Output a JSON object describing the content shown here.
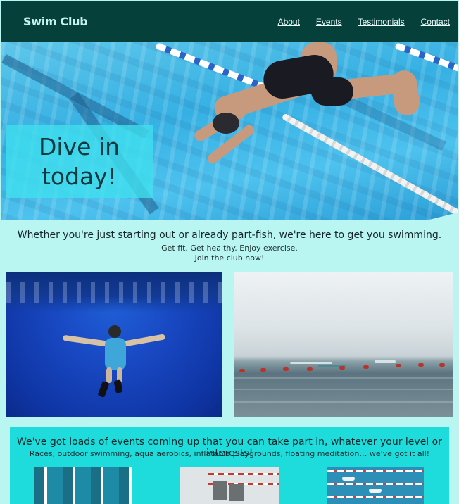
{
  "header": {
    "brand": "Swim Club",
    "nav": [
      "About",
      "Events",
      "Testimonials",
      "Contact"
    ]
  },
  "hero": {
    "title": "Dive in today!"
  },
  "intro": {
    "lead": "Whether you're just starting out or already part-fish, we're here to get you swimming.",
    "line1": "Get fit. Get healthy. Enjoy exercise.",
    "line2": "Join the club now!"
  },
  "events": {
    "heading": "We've got loads of events coming up that you can take part in, whatever your level or interests!",
    "subheading": "Races, outdoor swimming, aqua aerobics, inflatable playgrounds, floating meditation… we've got it all!"
  },
  "colors": {
    "header_bg": "#06403b",
    "page_bg": "#b9f5f1",
    "hero_box": "#40e0ee",
    "events_bg": "#1edcdc"
  }
}
